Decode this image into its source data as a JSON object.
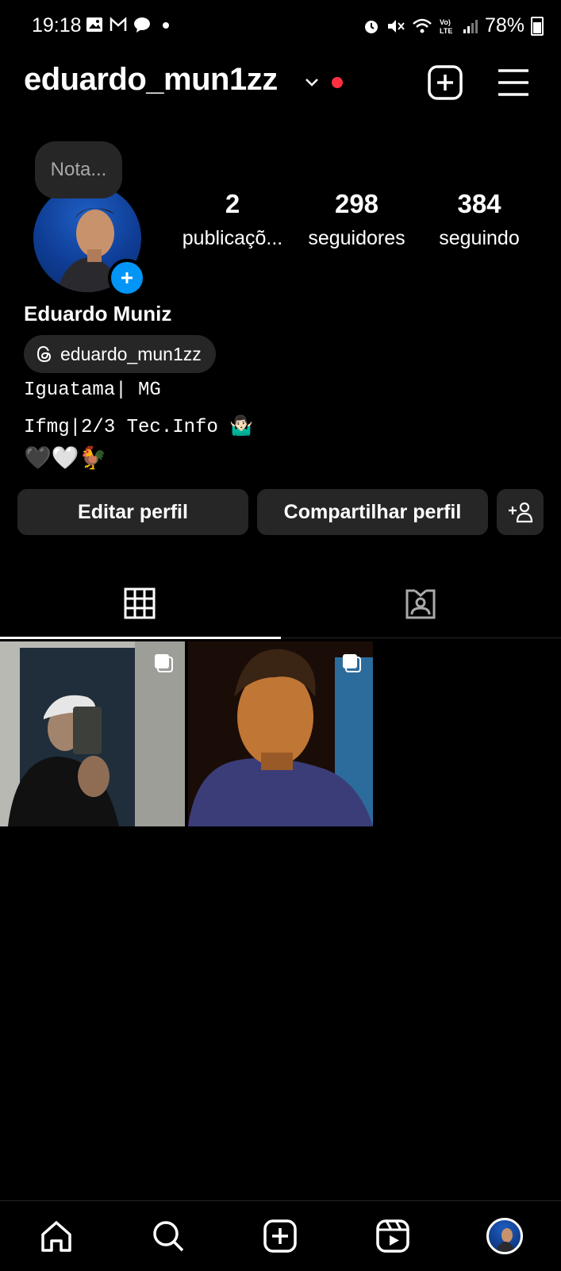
{
  "status_bar": {
    "time": "19:18",
    "battery": "78%",
    "left_icons": [
      "image-icon",
      "gmail-icon",
      "chat-icon",
      "dot-icon"
    ],
    "right_icons": [
      "alarm-icon",
      "mute-icon",
      "wifi-icon",
      "volte-icon",
      "signal-icon",
      "battery-icon"
    ]
  },
  "header": {
    "username": "eduardo_mun1zz",
    "notification_dot_color": "#ff3040"
  },
  "note": {
    "placeholder": "Nota..."
  },
  "stats": [
    {
      "value": "2",
      "label": "publicaçõ..."
    },
    {
      "value": "298",
      "label": "seguidores"
    },
    {
      "value": "384",
      "label": "seguindo"
    }
  ],
  "profile": {
    "full_name": "Eduardo Muniz",
    "threads_handle": "eduardo_mun1zz",
    "bio_line1": "Iguatama| MG",
    "bio_line2": "Ifmg|2/3 Tec.Info 🤷🏻‍♂️",
    "bio_line3": "🖤🤍🐓"
  },
  "buttons": {
    "edit": "Editar perfil",
    "share": "Compartilhar perfil"
  },
  "tabs": [
    "grid-icon",
    "tagged-icon"
  ],
  "accent": "#0095f6"
}
